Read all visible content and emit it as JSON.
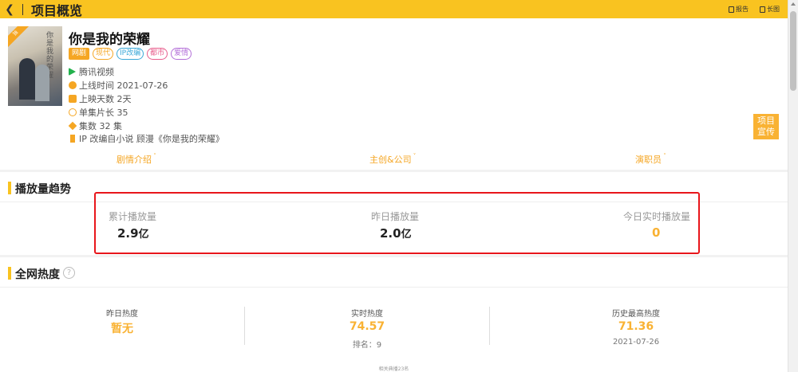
{
  "header": {
    "title": "项目概览",
    "actions": [
      {
        "icon": "report-icon",
        "label": "报告"
      },
      {
        "icon": "image-icon",
        "label": "长图"
      }
    ]
  },
  "drama": {
    "title": "你是我的荣耀",
    "poster_badge": "独",
    "tags": [
      {
        "label": "网剧",
        "color": "#f5a623"
      },
      {
        "label": "现代",
        "color": "#f5a623"
      },
      {
        "label": "IP改编",
        "color": "#3aa8d8"
      },
      {
        "label": "都市",
        "color": "#e85d8c"
      },
      {
        "label": "爱情",
        "color": "#b36fd8"
      }
    ],
    "platform": "腾讯视频",
    "release_date": "上线时间 2021-07-26",
    "days_aired": "上映天数 2天",
    "episode_length": "单集片长 35",
    "episodes": "集数 32 集",
    "ip_source": "IP 改编自小说 顾漫《你是我的荣耀》",
    "promo_label_1": "项目",
    "promo_label_2": "宣传"
  },
  "tabs": [
    "剧情介绍",
    "主创&公司",
    "演职员"
  ],
  "play_trend": {
    "title": "播放量趋势",
    "stats": [
      {
        "label": "累计播放量",
        "value": "2.9",
        "unit": "亿"
      },
      {
        "label": "昨日播放量",
        "value": "2.0",
        "unit": "亿"
      },
      {
        "label": "今日实时播放量",
        "value": "0",
        "unit": ""
      }
    ]
  },
  "heat": {
    "title": "全网热度",
    "help": "?",
    "stats": [
      {
        "label": "昨日热度",
        "value": "暂无",
        "sub": ""
      },
      {
        "label": "实时热度",
        "value": "74.57",
        "sub": "排名：9"
      },
      {
        "label": "历史最高热度",
        "value": "71.36",
        "sub": "2021-07-26"
      }
    ],
    "footnote": "相关典播23名"
  }
}
